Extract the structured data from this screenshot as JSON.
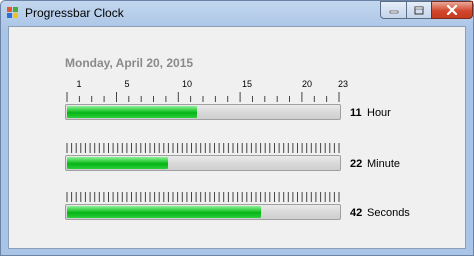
{
  "window": {
    "title": "Progressbar Clock"
  },
  "date": "Monday, April 20, 2015",
  "hour_scale": [
    "1",
    "5",
    "10",
    "15",
    "20",
    "23"
  ],
  "hour": {
    "value": "11",
    "unit": "Hour",
    "fraction": 0.478
  },
  "minute": {
    "value": "22",
    "unit": "Minute",
    "fraction": 0.373
  },
  "second": {
    "value": "42",
    "unit": "Seconds",
    "fraction": 0.712
  },
  "colors": {
    "progress_green": "#06b318",
    "titlebar_blue": "#a9c4e6",
    "close_red": "#c43b20"
  }
}
